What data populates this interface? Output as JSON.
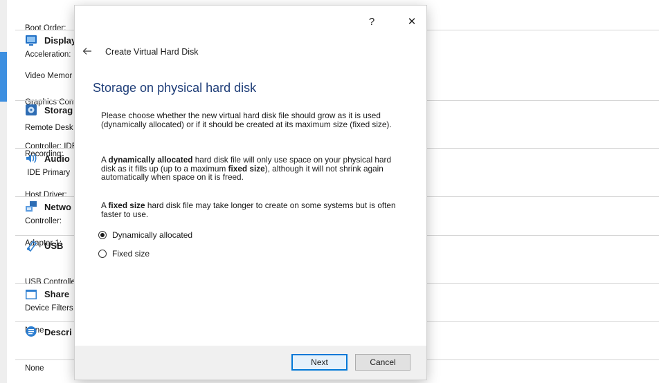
{
  "background": {
    "top_rows": [
      "Boot Order:",
      "Acceleration:"
    ],
    "sections": [
      {
        "title": "Display",
        "icon": "display-icon",
        "rows": [
          "Video Memor",
          "Graphics Con",
          "Remote Desk",
          "Recording:"
        ]
      },
      {
        "title": "Storag",
        "icon": "storage-icon",
        "rows": [
          "Controller: IDE",
          " IDE Primary"
        ]
      },
      {
        "title": "Audio",
        "icon": "audio-icon",
        "rows": [
          "Host Driver:",
          "Controller:"
        ]
      },
      {
        "title": "Netwo",
        "icon": "network-icon",
        "rows": [
          "Adapter 1:"
        ]
      },
      {
        "title": "USB",
        "icon": "usb-icon",
        "rows": [
          "USB Controlle",
          "Device Filters"
        ]
      },
      {
        "title": "Share",
        "icon": "shared-folder-icon",
        "rows": [
          "None"
        ]
      },
      {
        "title": "Descri",
        "icon": "description-icon",
        "rows": [
          "None"
        ]
      }
    ]
  },
  "dialog": {
    "help_label": "?",
    "close_label": "✕",
    "title": "Create Virtual Hard Disk",
    "heading": "Storage on physical hard disk",
    "intro": "Please choose whether the new virtual hard disk file should grow as it is used (dynamically allocated) or if it should be created at its maximum size (fixed size).",
    "dynamic_desc": {
      "a": "A ",
      "b1": "dynamically allocated",
      "c": " hard disk file will only use space on your physical hard disk as it fills up (up to a maximum ",
      "b2": "fixed size",
      "d": "), although it will not shrink again automatically when space on it is freed."
    },
    "fixed_desc": {
      "a": "A ",
      "b": "fixed size",
      "c": " hard disk file may take longer to create on some systems but is often faster to use."
    },
    "options": [
      {
        "label": "Dynamically allocated",
        "selected": true
      },
      {
        "label": "Fixed size",
        "selected": false
      }
    ],
    "buttons": {
      "next": "Next",
      "cancel": "Cancel"
    }
  },
  "colors": {
    "accent": "#3d8fe0",
    "heading": "#1e3d78",
    "default_button_border": "#0078d7"
  }
}
